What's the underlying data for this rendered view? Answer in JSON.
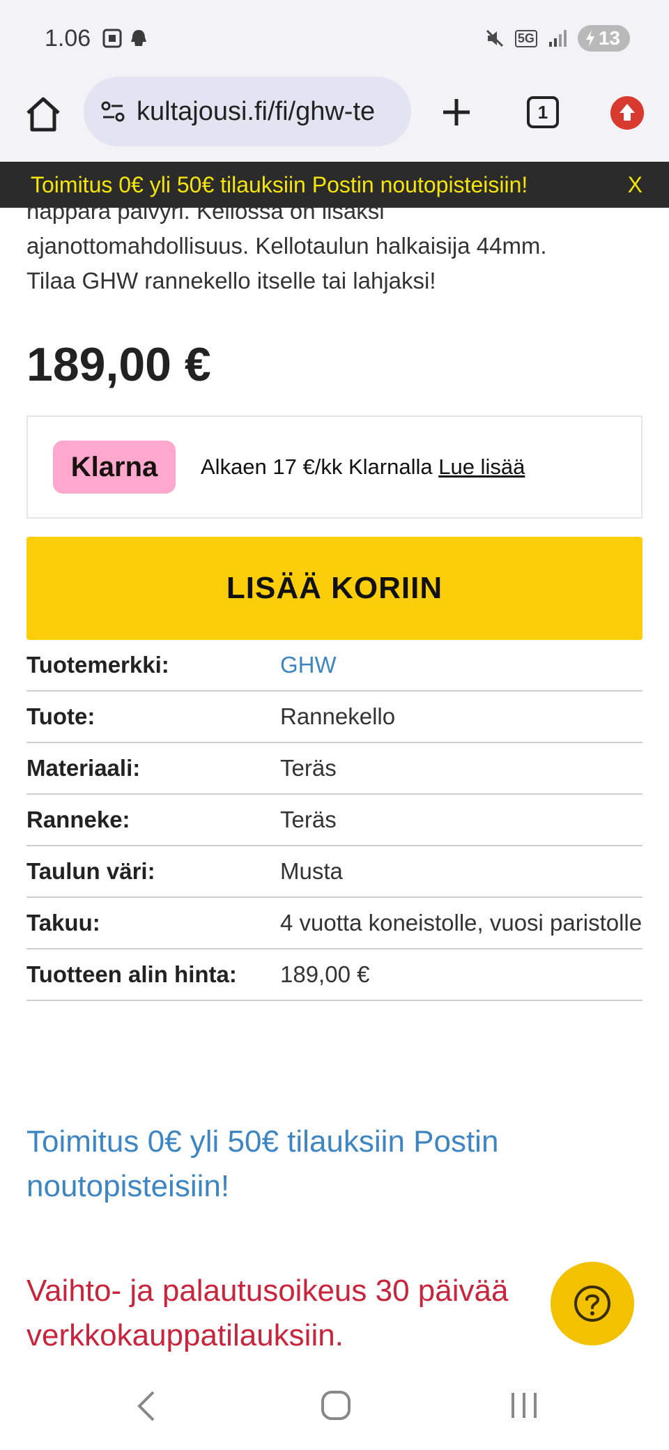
{
  "status_bar": {
    "time": "1.06",
    "network": "5G",
    "battery": "13"
  },
  "browser": {
    "url": "kultajousi.fi/fi/ghw-te",
    "tab_count": "1"
  },
  "promo_banner": {
    "text": "Toimitus 0€ yli 50€ tilauksiin Postin noutopisteisiin!",
    "close": "X"
  },
  "product": {
    "description_lines": [
      "nappara paivyri. Kellossa on lisaksi",
      "ajanottomahdollisuus. Kellotaulun halkaisija 44mm.",
      "Tilaa GHW rannekello itselle tai lahjaksi!"
    ],
    "price": "189,00 €"
  },
  "klarna": {
    "logo": "Klarna",
    "text": "Alkaen 17 €/kk Klarnalla",
    "link": "Lue lisää"
  },
  "cart": {
    "button_label": "LISÄÄ KORIIN"
  },
  "specs": [
    {
      "label": "Tuotemerkki:",
      "value": "GHW"
    },
    {
      "label": "Tuote:",
      "value": "Rannekello"
    },
    {
      "label": "Materiaali:",
      "value": "Teräs"
    },
    {
      "label": "Ranneke:",
      "value": "Teräs"
    },
    {
      "label": "Taulun väri:",
      "value": "Musta"
    },
    {
      "label": "Takuu:",
      "value": "4 vuotta koneistolle, vuosi paristolle"
    },
    {
      "label": "Tuotteen alin hinta:",
      "value": "189,00 €"
    }
  ],
  "notes": {
    "shipping": "Toimitus 0€ yli 50€ tilauksiin Postin noutopisteisiin!",
    "returns": "Vaihto- ja palautusoikeus 30 päivää verkkokauppatilauksiin."
  },
  "colors": {
    "accent_yellow": "#fcce0a",
    "link_blue": "#3e86c2",
    "returns_red": "#c8243c",
    "klarna_pink": "#ffa8cd",
    "banner_text": "#f5e50a"
  }
}
